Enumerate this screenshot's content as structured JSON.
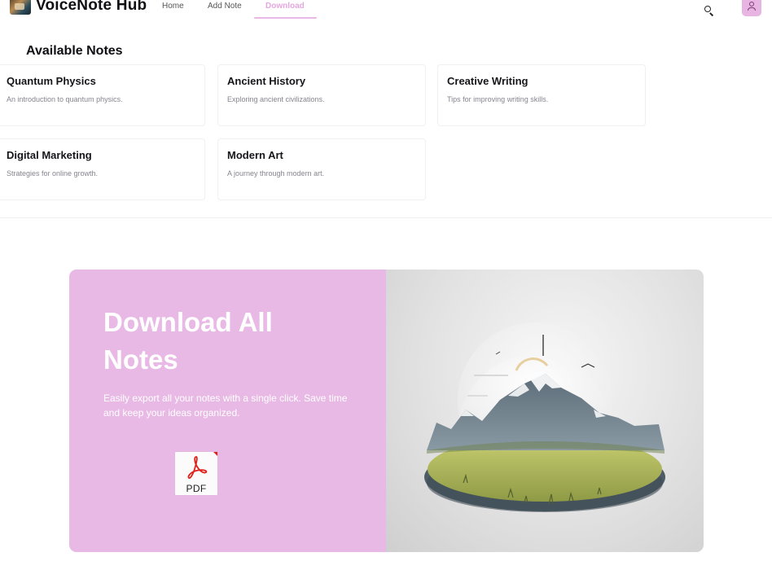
{
  "header": {
    "brand": "VoiceNote Hub",
    "nav": {
      "home": "Home",
      "add_note": "Add Note",
      "download": "Download"
    },
    "active_tab": "Download",
    "icons": {
      "search": "search-icon",
      "user": "user-icon"
    }
  },
  "notes_section": {
    "title": "Available Notes",
    "notes": [
      {
        "title": "Quantum Physics",
        "description": "An introduction to quantum physics."
      },
      {
        "title": "Ancient History",
        "description": "Exploring ancient civilizations."
      },
      {
        "title": "Creative Writing",
        "description": "Tips for improving writing skills."
      },
      {
        "title": "Digital Marketing",
        "description": "Strategies for online growth."
      },
      {
        "title": "Modern Art",
        "description": "A journey through modern art."
      }
    ]
  },
  "hero": {
    "title": "Download All Notes",
    "description": "Easily export all your notes with a single click. Save time and keep your ideas organized.",
    "pdf_label": "PDF"
  },
  "colors": {
    "accent": "#e8b9e5",
    "accent_text": "#e6a6df",
    "pdf_red": "#e0201a"
  }
}
